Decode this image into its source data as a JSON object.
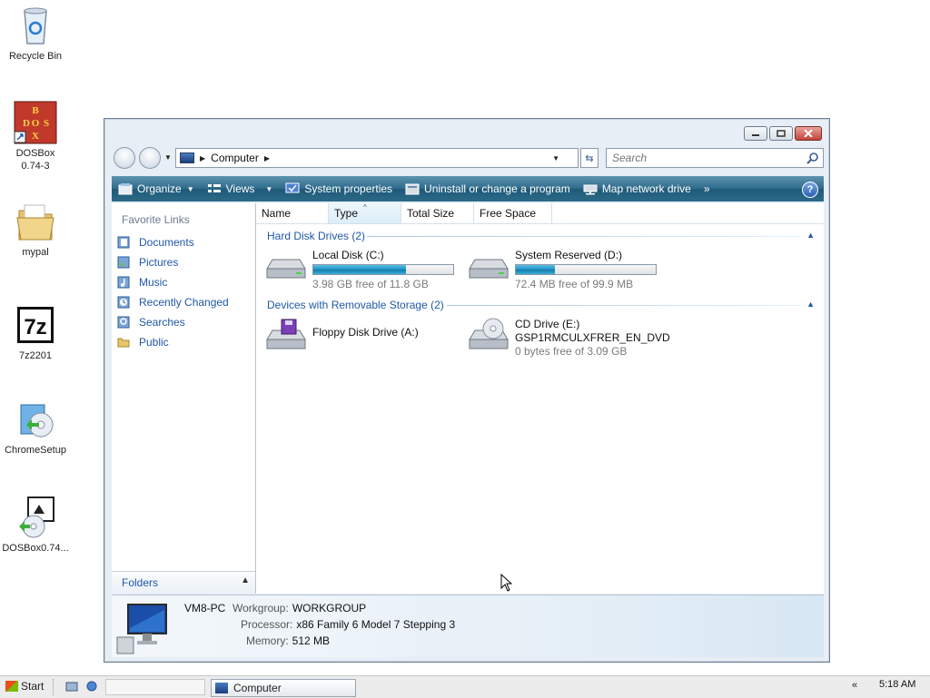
{
  "desktop": {
    "icons": [
      {
        "label": "Recycle Bin",
        "icon": "recycle-bin-icon"
      },
      {
        "label": "DOSBox 0.74-3",
        "icon": "dosbox-icon"
      },
      {
        "label": "mypal",
        "icon": "folder-icon"
      },
      {
        "label": "7z2201",
        "icon": "7zip-icon"
      },
      {
        "label": "ChromeSetup",
        "icon": "installer-icon"
      },
      {
        "label": "DOSBox0.74...",
        "icon": "installer-icon"
      }
    ]
  },
  "window": {
    "address": {
      "crumb": "Computer"
    },
    "search": {
      "placeholder": "Search"
    },
    "toolbar": {
      "organize": "Organize",
      "views": "Views",
      "system_properties": "System properties",
      "uninstall": "Uninstall or change a program",
      "map_drive": "Map network drive",
      "more": "»"
    },
    "nav": {
      "header": "Favorite Links",
      "items": [
        "Documents",
        "Pictures",
        "Music",
        "Recently Changed",
        "Searches",
        "Public"
      ],
      "folders_label": "Folders"
    },
    "columns": [
      "Name",
      "Type",
      "Total Size",
      "Free Space"
    ],
    "groups": {
      "hard_disks": "Hard Disk Drives (2)",
      "removable": "Devices with Removable Storage (2)"
    },
    "drives": {
      "c": {
        "name": "Local Disk (C:)",
        "free": "3.98 GB free of 11.8 GB",
        "used_fraction": 0.66
      },
      "d": {
        "name": "System Reserved (D:)",
        "free": "72.4 MB free of 99.9 MB",
        "used_fraction": 0.28
      },
      "a": {
        "name": "Floppy Disk Drive (A:)"
      },
      "e": {
        "name": "CD Drive (E:)",
        "label": "GSP1RMCULXFRER_EN_DVD",
        "free": "0 bytes free of 3.09 GB"
      }
    },
    "details": {
      "pc_name": "VM8-PC",
      "workgroup_key": "Workgroup:",
      "workgroup_val": "WORKGROUP",
      "processor_key": "Processor:",
      "processor_val": "x86 Family 6 Model 7 Stepping 3",
      "memory_key": "Memory:",
      "memory_val": "512 MB"
    }
  },
  "taskbar": {
    "start": "Start",
    "task": "Computer",
    "tray_arrow": "«",
    "clock": "5:18 AM"
  },
  "colors": {
    "toolbar": "#2f6c8c",
    "link": "#1f58a6",
    "progress": "#1f8fc3"
  }
}
